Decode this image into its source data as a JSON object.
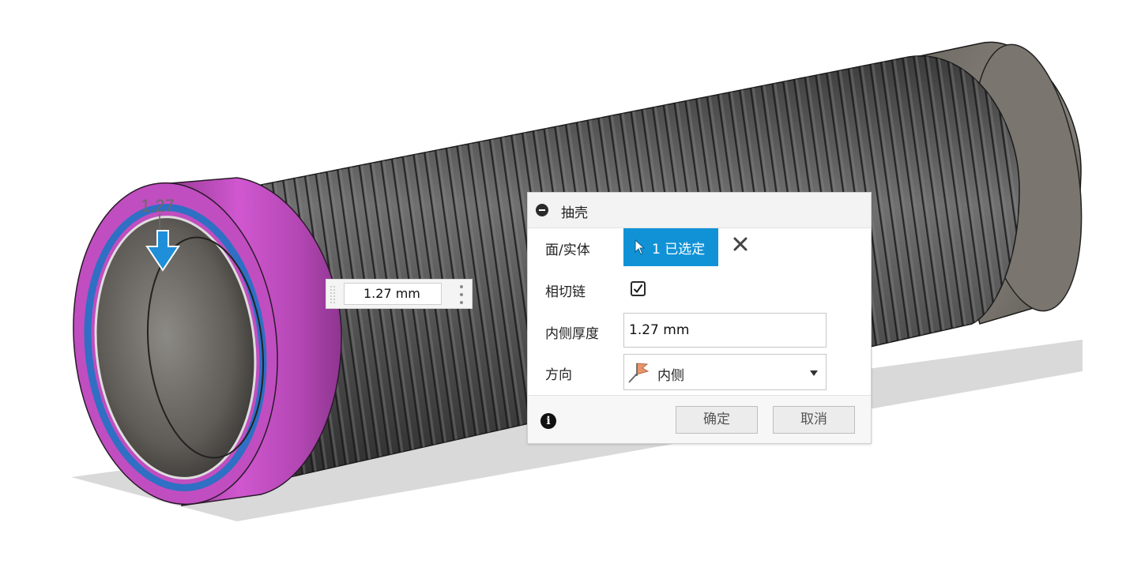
{
  "viewport": {
    "dimension_label": "1.27",
    "face_color": "#c04ec0",
    "selection_ring_color": "#2f6fc4",
    "direction_arrow_color": "#1e8fd8"
  },
  "float_input": {
    "value": "1.27 mm",
    "menu_icon": "kebab-icon"
  },
  "dialog": {
    "title": "抽壳",
    "collapse_icon": "minus-circle-icon",
    "rows": {
      "faces_label": "面/实体",
      "selection_text": "1 已选定",
      "selection_icon": "cursor-arrow-icon",
      "clear_icon": "close-icon",
      "tangent_label": "相切链",
      "tangent_checked": true,
      "thickness_label": "内侧厚度",
      "thickness_value": "1.27 mm",
      "direction_label": "方向",
      "direction_value": "内侧",
      "direction_icon": "flag-direction-icon"
    },
    "footer": {
      "info_icon": "info-icon",
      "ok_label": "确定",
      "cancel_label": "取消"
    },
    "accent_color": "#1192d6"
  }
}
